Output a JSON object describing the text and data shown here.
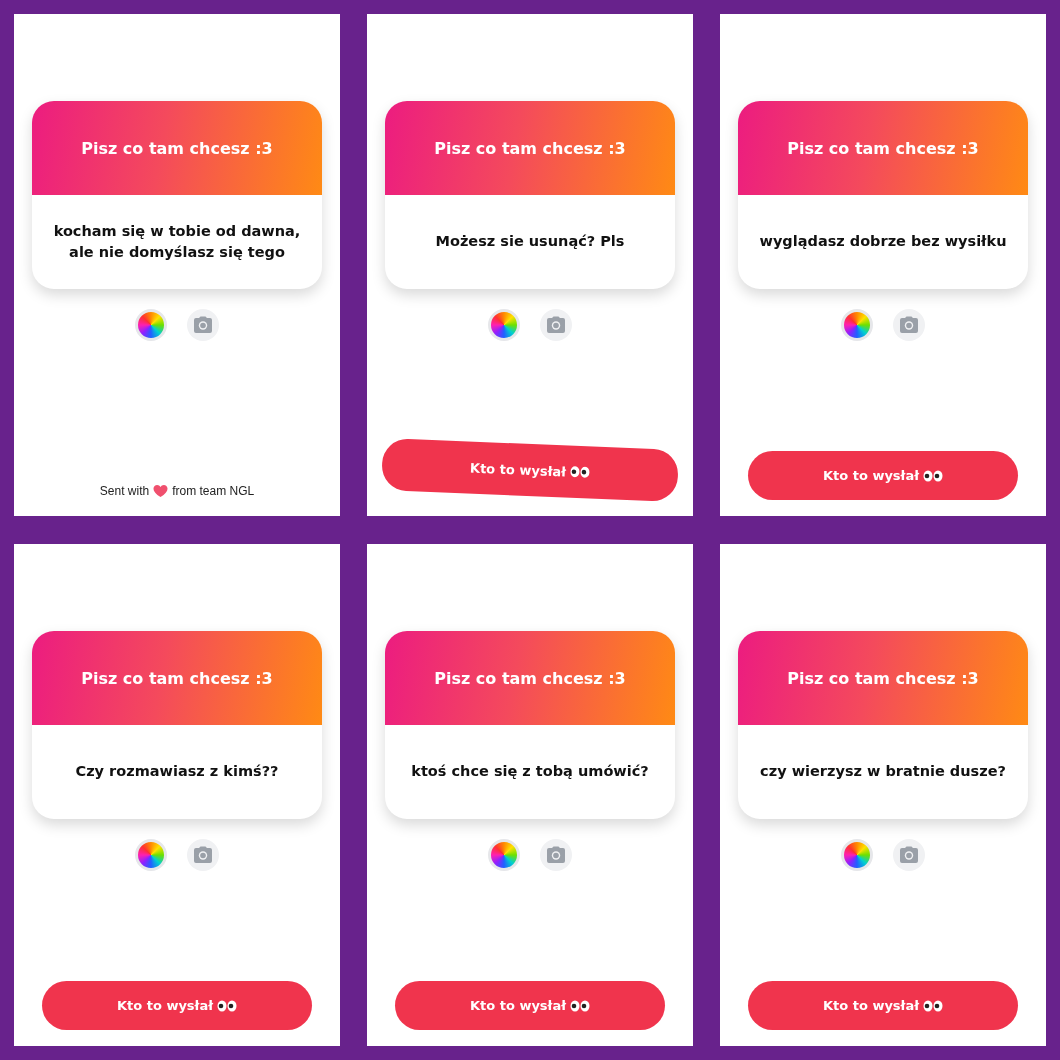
{
  "screens": [
    {
      "title": "Pisz co tam chcesz :3",
      "message": "kocham się w tobie od dawna, ale nie domyślasz się tego",
      "footer": {
        "kind": "credit",
        "before": "Sent with",
        "after": "from team NGL"
      }
    },
    {
      "title": "Pisz co tam chcesz :3",
      "message": "Możesz sie usunąć? Pls",
      "footer": {
        "kind": "button",
        "label": "Kto to wysłał",
        "tilted": true
      }
    },
    {
      "title": "Pisz co tam chcesz :3",
      "message": "wyglądasz dobrze bez wysiłku",
      "footer": {
        "kind": "button",
        "label": "Kto to wysłał",
        "tilted": false
      }
    },
    {
      "title": "Pisz co tam chcesz :3",
      "message": "Czy rozmawiasz z kimś??",
      "footer": {
        "kind": "button",
        "label": "Kto to wysłał",
        "tilted": false
      }
    },
    {
      "title": "Pisz co tam chcesz :3",
      "message": "ktoś chce się z tobą umówić?",
      "footer": {
        "kind": "button",
        "label": "Kto to wysłał",
        "tilted": false
      }
    },
    {
      "title": "Pisz co tam chcesz :3",
      "message": "czy wierzysz w bratnie dusze?",
      "footer": {
        "kind": "button",
        "label": "Kto to wysłał",
        "tilted": false
      }
    }
  ]
}
